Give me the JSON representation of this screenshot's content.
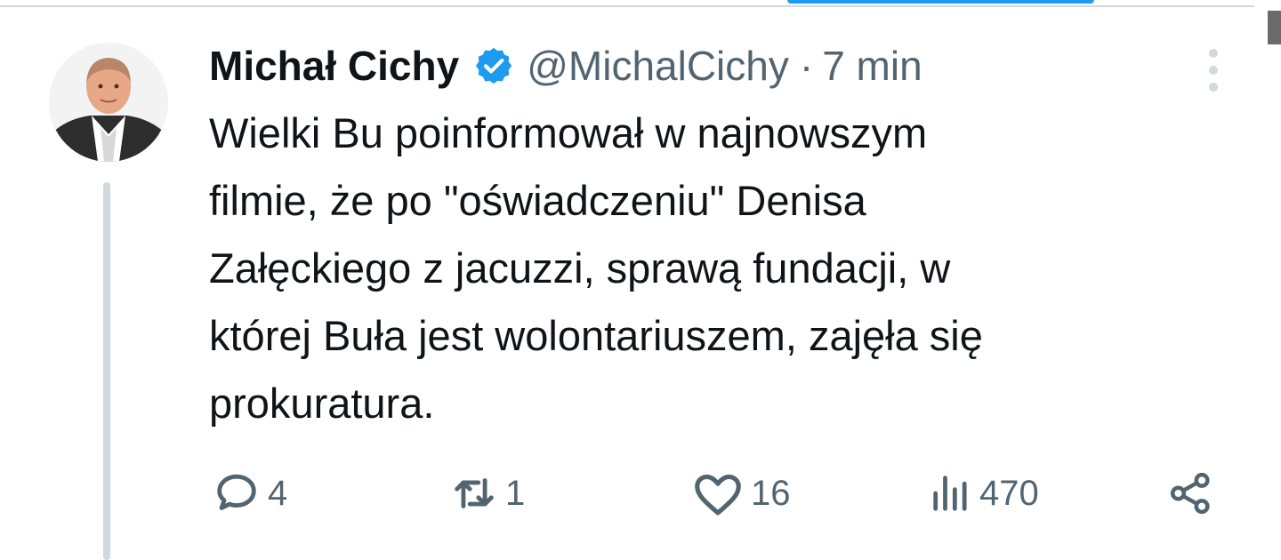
{
  "tweet": {
    "author_name": "Michał Cichy",
    "handle": "@MichalCichy",
    "separator": "·",
    "time": "7 min",
    "text": "Wielki Bu poinformował w najnowszym\nfilmie, że po \"oświadczeniu\" Denisa\nZałęckiego z jacuzzi, sprawą fundacji, w\nktórej Buła jest wolontariuszem, zajęła się\nprokuratura."
  },
  "actions": {
    "replies": "4",
    "retweets": "1",
    "likes": "16",
    "views": "470"
  },
  "icons": {
    "verified": "verified-badge-icon",
    "more": "more-vertical-icon",
    "reply": "reply-icon",
    "retweet": "retweet-icon",
    "like": "heart-icon",
    "views": "views-chart-icon",
    "share": "share-icon"
  },
  "colors": {
    "accent": "#1d9bf0",
    "text_primary": "#0f1419",
    "text_secondary": "#536471",
    "divider": "#cfd9de"
  }
}
